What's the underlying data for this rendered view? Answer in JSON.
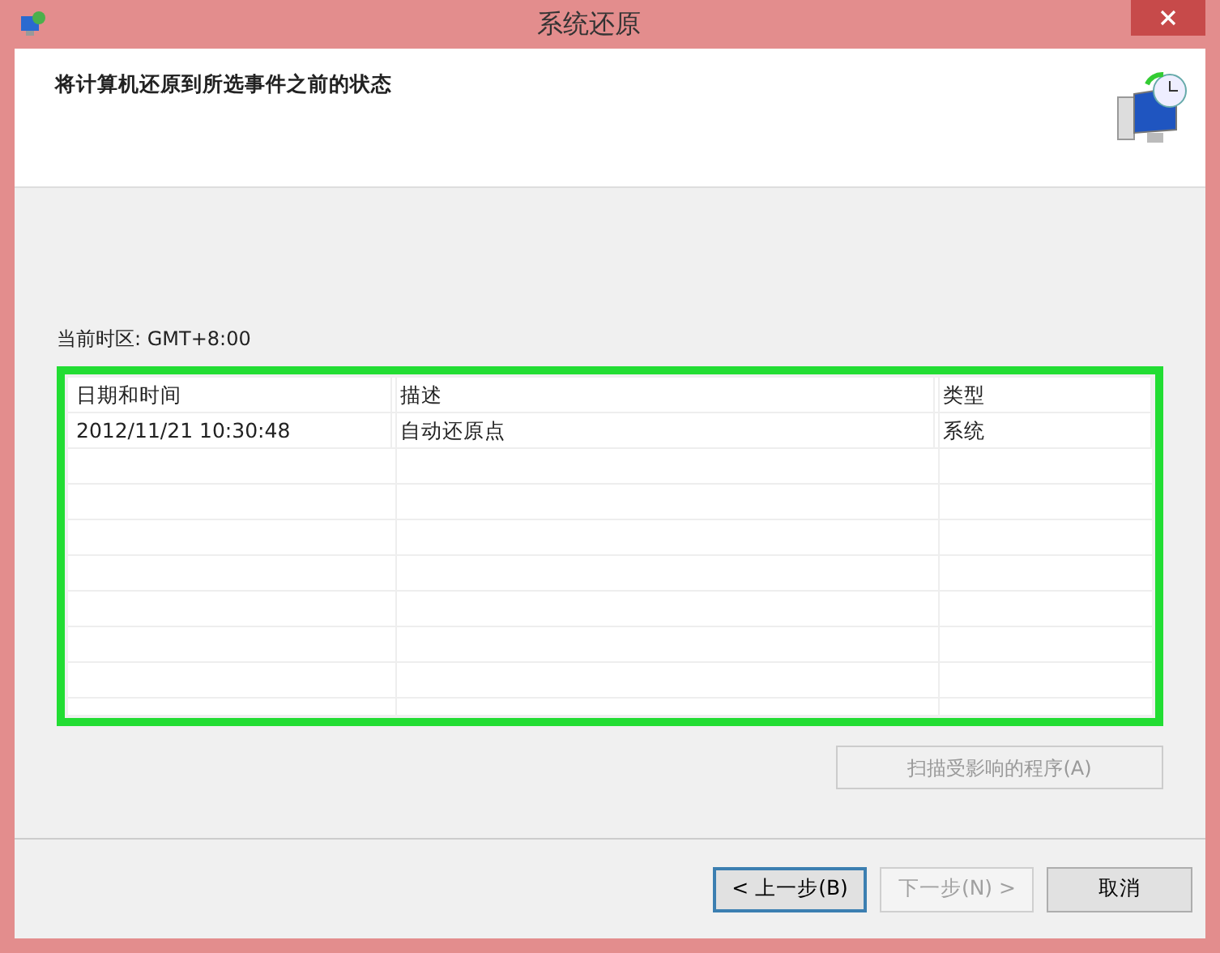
{
  "window": {
    "title": "系统还原"
  },
  "header": {
    "heading": "将计算机还原到所选事件之前的状态"
  },
  "timezone": "当前时区: GMT+8:00",
  "table": {
    "highlighted": true,
    "columns": [
      "日期和时间",
      "描述",
      "类型"
    ],
    "rows": [
      {
        "cells": [
          "2012/11/21 10:30:48",
          "自动还原点",
          "系统"
        ],
        "selected": false
      }
    ]
  },
  "scan_button": {
    "label": "扫描受影响的程序(A)",
    "disabled": true
  },
  "buttons": [
    {
      "label": "< 上一步(B)",
      "disabled": false,
      "default": true
    },
    {
      "label": "下一步(N) >",
      "disabled": true,
      "default": false
    },
    {
      "label": "取消",
      "disabled": false,
      "default": false
    }
  ]
}
